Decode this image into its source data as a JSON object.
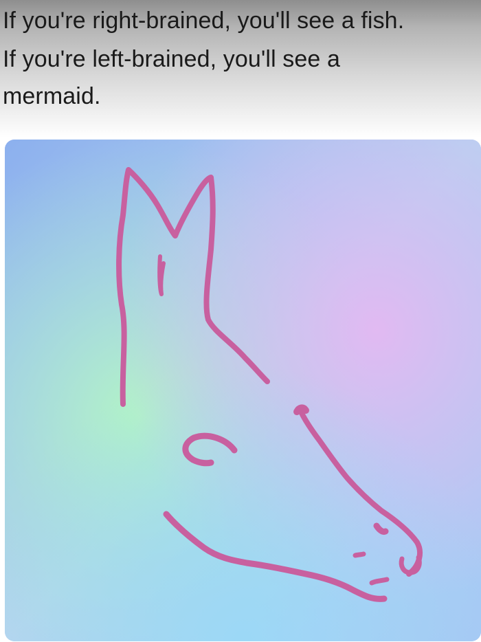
{
  "post": {
    "caption_line_1": "If you're right-brained, you'll see a fish.",
    "caption_line_2": "If you're left-brained, you'll see a",
    "caption_line_3": "mermaid."
  },
  "illusion_image": {
    "line_color": "#c8609f",
    "background_colors": [
      "#8fb4f0",
      "#a5f0c5",
      "#d8b5f0",
      "#9fd8f8"
    ]
  }
}
